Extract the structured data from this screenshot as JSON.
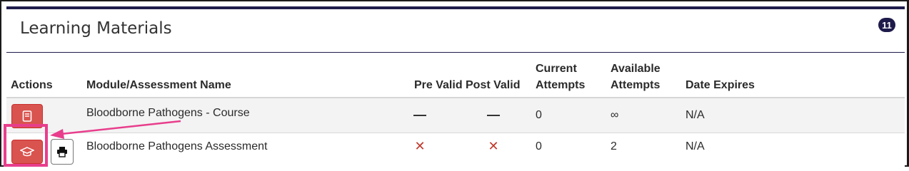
{
  "panel": {
    "title": "Learning Materials",
    "count": "11"
  },
  "table": {
    "headers": {
      "actions": "Actions",
      "name": "Module/Assessment Name",
      "pre_valid": "Pre Valid",
      "post_valid": "Post Valid",
      "current_attempts_line1": "Current",
      "current_attempts_line2": "Attempts",
      "available_attempts_line1": "Available",
      "available_attempts_line2": "Attempts",
      "date_expires": "Date Expires"
    },
    "rows": [
      {
        "name": "Bloodborne Pathogens - Course",
        "pre_valid": "—",
        "post_valid": "—",
        "current_attempts": "0",
        "available_attempts": "∞",
        "date_expires": "N/A",
        "action_icon": "book-icon"
      },
      {
        "name": "Bloodborne Pathogens Assessment",
        "pre_valid": "✕",
        "post_valid": "✕",
        "current_attempts": "0",
        "available_attempts": "2",
        "date_expires": "N/A",
        "action_icon": "graduation-cap-icon",
        "secondary_action_icon": "print-icon"
      }
    ]
  },
  "colors": {
    "header_accent": "#1e1b4b",
    "action_button": "#d9534f",
    "highlight": "#e83e8c",
    "status_invalid": "#c0392b"
  }
}
